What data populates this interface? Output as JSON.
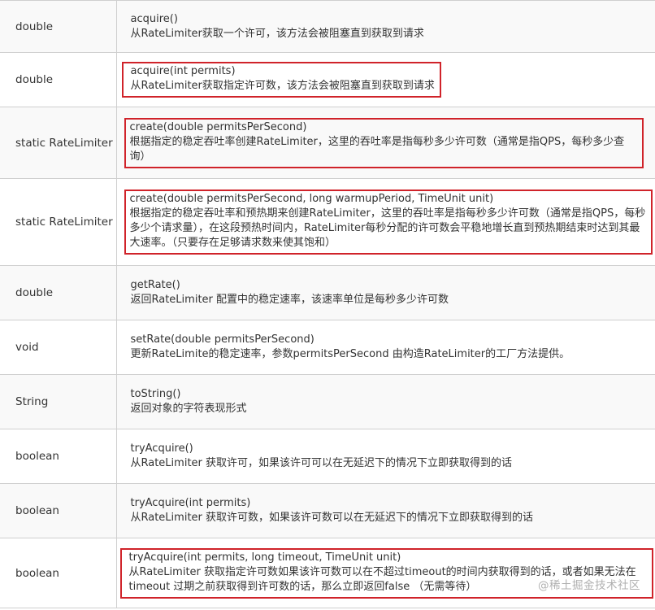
{
  "rows": [
    {
      "type": "double",
      "signature": "acquire()",
      "description": "从RateLimiter获取一个许可，该方法会被阻塞直到获取到请求"
    },
    {
      "type": "double",
      "signature": "acquire(int permits)",
      "description": "从RateLimiter获取指定许可数，该方法会被阻塞直到获取到请求"
    },
    {
      "type": "static RateLimiter",
      "signature": "create(double permitsPerSecond)",
      "description": "根据指定的稳定吞吐率创建RateLimiter，这里的吞吐率是指每秒多少许可数（通常是指QPS，每秒多少查询）"
    },
    {
      "type": "static RateLimiter",
      "signature": "create(double permitsPerSecond, long warmupPeriod, TimeUnit unit)",
      "description": "根据指定的稳定吞吐率和预热期来创建RateLimiter，这里的吞吐率是指每秒多少许可数（通常是指QPS，每秒多少个请求量），在这段预热时间内，RateLimiter每秒分配的许可数会平稳地增长直到预热期结束时达到其最大速率。（只要存在足够请求数来使其饱和）"
    },
    {
      "type": "double",
      "signature": "getRate()",
      "description": "返回RateLimiter 配置中的稳定速率，该速率单位是每秒多少许可数"
    },
    {
      "type": "void",
      "signature": "setRate(double permitsPerSecond)",
      "description": "更新RateLimite的稳定速率，参数permitsPerSecond 由构造RateLimiter的工厂方法提供。"
    },
    {
      "type": "String",
      "signature": "toString()",
      "description": "返回对象的字符表现形式"
    },
    {
      "type": "boolean",
      "signature": "tryAcquire()",
      "description": "从RateLimiter 获取许可，如果该许可可以在无延迟下的情况下立即获取得到的话"
    },
    {
      "type": "boolean",
      "signature": "tryAcquire(int permits)",
      "description": "从RateLimiter 获取许可数，如果该许可数可以在无延迟下的情况下立即获取得到的话"
    },
    {
      "type": "boolean",
      "signature": "tryAcquire(int permits, long timeout, TimeUnit unit)",
      "description": "从RateLimiter 获取指定许可数如果该许可数可以在不超过timeout的时间内获取得到的话，或者如果无法在timeout 过期之前获取得到许可数的话，那么立即返回false （无需等待）"
    }
  ],
  "watermark": "@稀土掘金技术社区",
  "colors": {
    "highlight_border": "#d0232a",
    "row_alt_background": "#f9f9f9",
    "grid_line": "#cfcfcf",
    "text": "#333333"
  }
}
